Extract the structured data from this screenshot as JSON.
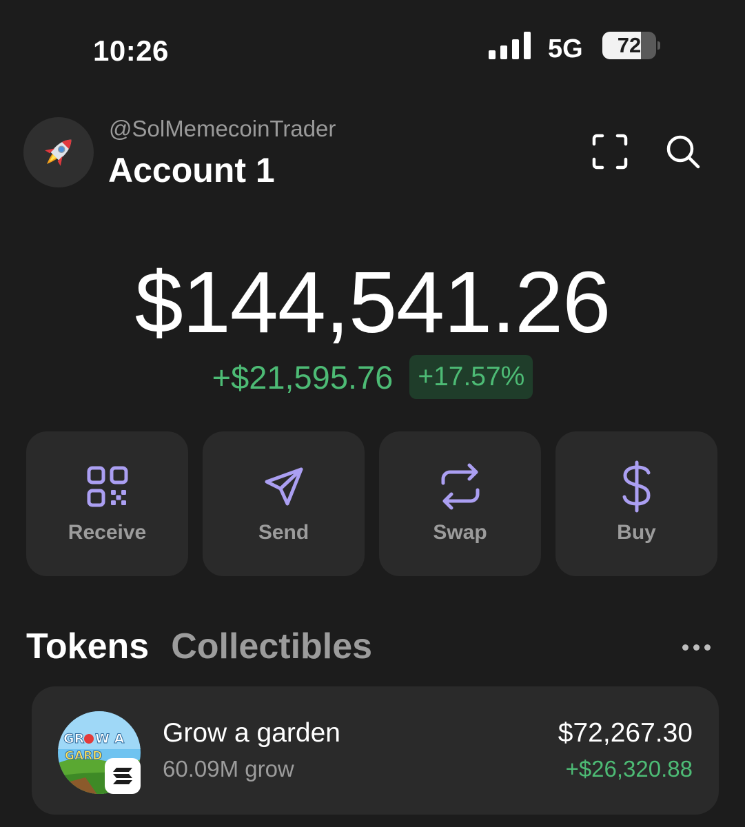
{
  "status_bar": {
    "time": "10:26",
    "network": "5G",
    "battery_percent": "72",
    "battery_level": 0.72
  },
  "account": {
    "avatar_emoji_icon": "rocket-icon",
    "username": "@SolMemecoinTrader",
    "name": "Account 1"
  },
  "header_icons": [
    "scan-icon",
    "search-icon"
  ],
  "balance": {
    "total": "$144,541.26",
    "change_amount": "+$21,595.76",
    "change_percent": "+17.57%"
  },
  "actions": [
    {
      "label": "Receive",
      "icon": "qr-code-icon"
    },
    {
      "label": "Send",
      "icon": "paper-plane-icon"
    },
    {
      "label": "Swap",
      "icon": "swap-arrows-icon"
    },
    {
      "label": "Buy",
      "icon": "dollar-icon"
    }
  ],
  "tabs": [
    {
      "label": "Tokens",
      "active": true
    },
    {
      "label": "Collectibles",
      "active": false
    }
  ],
  "tokens": [
    {
      "name": "Grow a garden",
      "amount": "60.09M grow",
      "value": "$72,267.30",
      "change": "+$26,320.88",
      "logo_text": "GROW A GARDEN",
      "chain_icon": "solana-icon"
    }
  ],
  "colors": {
    "background": "#1c1c1c",
    "card": "#2a2a2a",
    "positive": "#4dbb75",
    "accent_purple": "#ab9ff2",
    "muted": "#9c9c9c"
  }
}
